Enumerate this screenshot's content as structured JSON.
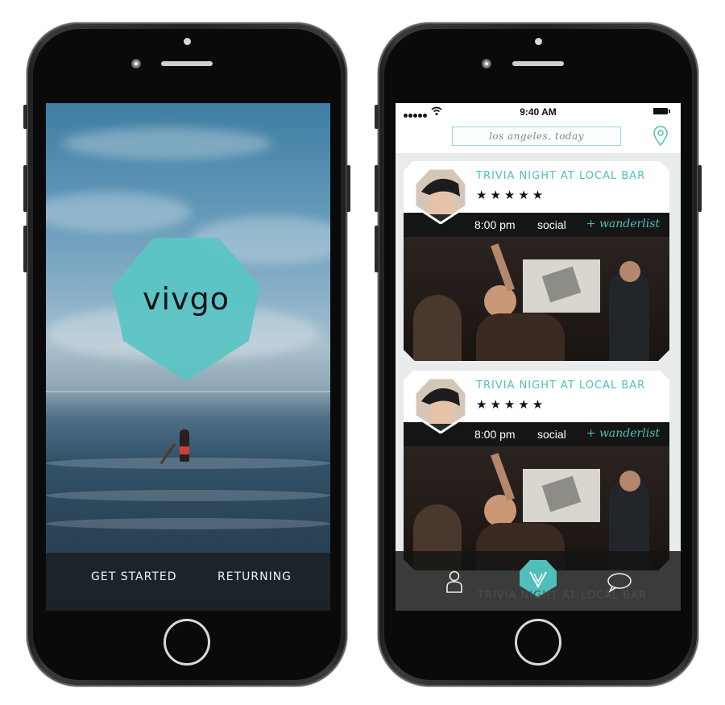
{
  "left_screen": {
    "logo": "vivgo",
    "buttons": {
      "get_started": "GET STARTED",
      "returning": "RETURNING"
    }
  },
  "right_screen": {
    "status_bar": {
      "time": "9:40 AM"
    },
    "search": {
      "value": "los angeles, today"
    },
    "cards": [
      {
        "title": "TRIVIA NIGHT AT LOCAL BAR",
        "rating": "★★★★★",
        "time": "8:00 pm",
        "category": "social",
        "wanderlist": "+ wanderlist"
      },
      {
        "title": "TRIVIA NIGHT AT LOCAL BAR",
        "rating": "★★★★★",
        "time": "8:00 pm",
        "category": "social",
        "wanderlist": "+ wanderlist"
      }
    ],
    "peek_card_title": "TRIVIA NIGHT AT LOCAL BAR",
    "tabbar": {
      "profile_icon": "person-icon",
      "home_icon": "vivgo-logo-icon",
      "chat_icon": "chat-bubble-icon"
    }
  },
  "colors": {
    "accent": "#4fbfbb",
    "logo_bg": "#5cc4c4",
    "bar_dark": "#151515"
  }
}
